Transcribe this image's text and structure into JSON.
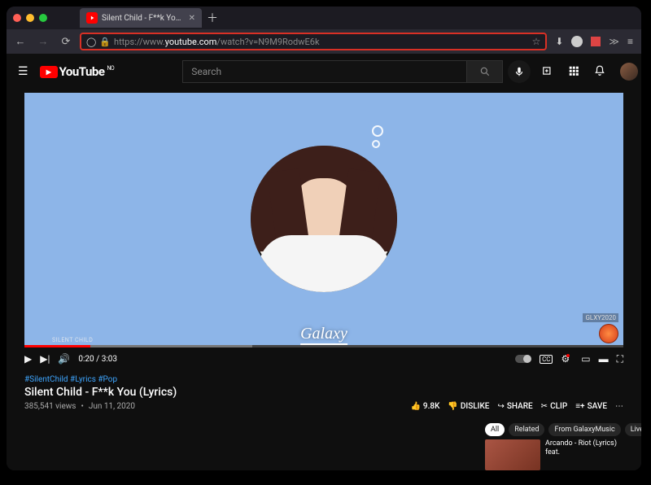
{
  "browser": {
    "tab_title": "Silent Child - F**k You (Lyrics) -",
    "url_scheme": "https://www.",
    "url_domain": "youtube.com",
    "url_path": "/watch?v=N9M9RodwE6k"
  },
  "header": {
    "brand": "YouTube",
    "country": "NO",
    "search_placeholder": "Search"
  },
  "player": {
    "channel_watermark_small": "SILENT CHILD",
    "current_time": "0:20",
    "duration": "3:03",
    "center_logo": "Galaxy",
    "corner_tag": "GLXY2020"
  },
  "video": {
    "hashtags": "#SilentChild #Lyrics #Pop",
    "title": "Silent Child - F**k You (Lyrics)",
    "views": "385,541 views",
    "date": "Jun 11, 2020"
  },
  "actions": {
    "likes": "9.8K",
    "dislike": "DISLIKE",
    "share": "SHARE",
    "clip": "CLIP",
    "save": "SAVE"
  },
  "filters": {
    "all": "All",
    "related": "Related",
    "from": "From GalaxyMusic",
    "live": "Live"
  },
  "related_video": {
    "title": "Arcando - Riot (Lyrics) feat."
  }
}
